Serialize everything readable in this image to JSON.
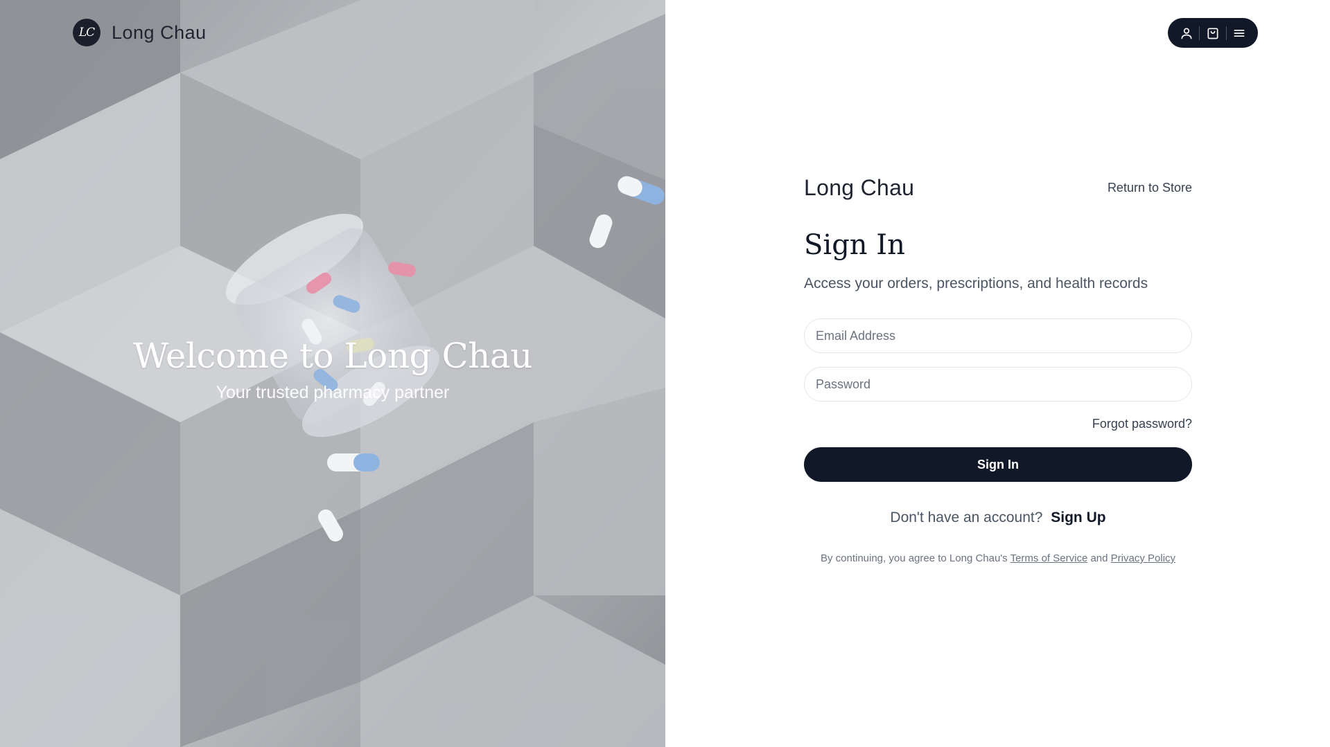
{
  "header": {
    "brand_initials": "LC",
    "brand_name": "Long Chau",
    "icons": [
      "user-icon",
      "shopping-bag-icon",
      "menu-icon"
    ]
  },
  "hero": {
    "title": "Welcome to Long Chau",
    "subtitle": "Your trusted pharmacy partner"
  },
  "form": {
    "brand": "Long Chau",
    "return_label": "Return to Store",
    "title": "Sign In",
    "subtitle": "Access your orders, prescriptions, and health records",
    "email_placeholder": "Email Address",
    "email_value": "",
    "password_placeholder": "Password",
    "password_value": "",
    "forgot_label": "Forgot password?",
    "submit_label": "Sign In",
    "signup_prompt": "Don't have an account?",
    "signup_label": "Sign Up",
    "legal_prefix": "By continuing, you agree to Long Chau's",
    "terms_label": "Terms of Service",
    "legal_and": "and",
    "privacy_label": "Privacy Policy"
  },
  "colors": {
    "primary": "#111827",
    "text_muted": "#4b5563",
    "border": "#e5e7eb",
    "hero_background": "#b9bbbf"
  }
}
